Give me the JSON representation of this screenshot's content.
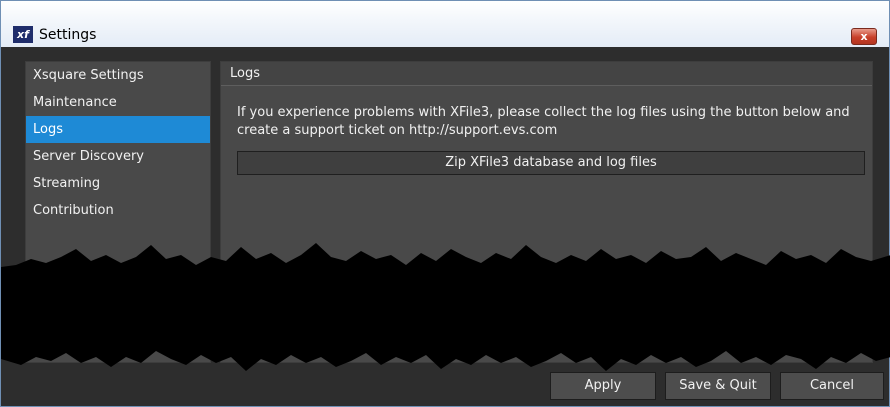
{
  "window": {
    "title": "Settings",
    "close_label": "x"
  },
  "sidebar": {
    "items": [
      {
        "label": "Xsquare Settings"
      },
      {
        "label": "Maintenance"
      },
      {
        "label": "Logs"
      },
      {
        "label": "Server Discovery"
      },
      {
        "label": "Streaming"
      },
      {
        "label": "Contribution"
      }
    ],
    "selected": "Logs"
  },
  "panel": {
    "header": "Logs",
    "description_line1": "If you experience problems with XFile3, please collect the log files using the button below and",
    "description_line2": "create a support ticket on http://support.evs.com",
    "zip_button": "Zip XFile3 database and log files"
  },
  "footer": {
    "apply": "Apply",
    "save_quit": "Save & Quit",
    "cancel": "Cancel"
  },
  "colors": {
    "accent": "#1e8ad6",
    "background": "#2d2d2d",
    "panel": "#494949"
  }
}
